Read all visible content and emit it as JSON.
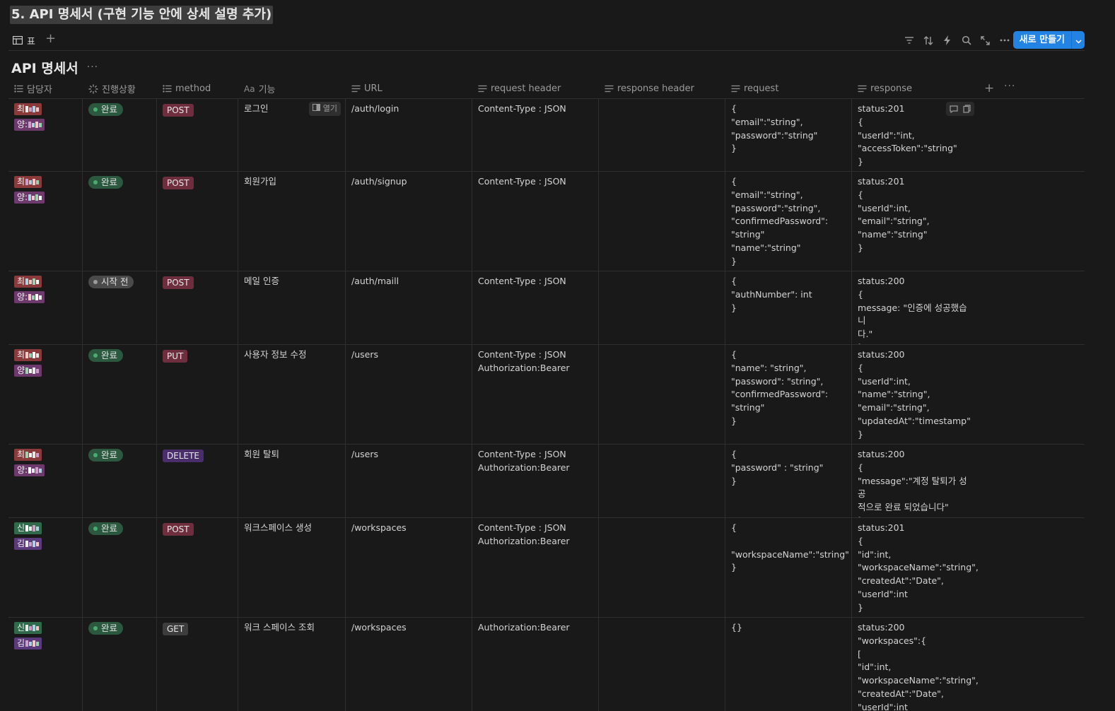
{
  "page": {
    "title": "5. API 명세서 (구현 기능 안에 상세 설명 추가)"
  },
  "toolbar": {
    "view_label": "표",
    "add_view": "+",
    "new_button": "새로 만들기"
  },
  "database": {
    "title": "API 명세서",
    "more": "···"
  },
  "columns": [
    {
      "key": "owner",
      "label": "담당자",
      "icon": "list-icon"
    },
    {
      "key": "status",
      "label": "진행상황",
      "icon": "status-icon"
    },
    {
      "key": "method",
      "label": "method",
      "icon": "list-icon"
    },
    {
      "key": "feature",
      "label": "기능",
      "icon": "title-icon",
      "icon_text": "Aa"
    },
    {
      "key": "url",
      "label": "URL",
      "icon": "text-icon"
    },
    {
      "key": "request_header",
      "label": "request header",
      "icon": "text-icon"
    },
    {
      "key": "response_header",
      "label": "response header",
      "icon": "text-icon"
    },
    {
      "key": "request",
      "label": "request",
      "icon": "text-icon"
    },
    {
      "key": "response",
      "label": "response",
      "icon": "text-icon"
    }
  ],
  "row_actions": {
    "open_label": "열기"
  },
  "rows": [
    {
      "owners": [
        {
          "name": "최",
          "color": "#8a3a3a"
        },
        {
          "name": "양:",
          "color": "#6e3a6e"
        }
      ],
      "status": "완료",
      "method": "POST",
      "feature": "로그인",
      "url": "/auth/login",
      "request_header": "Content-Type : JSON",
      "response_header": "",
      "request": "{\n\"email\":\"string\",\n\"password\":\"string\"\n}",
      "response": "status:201\n{\n\"userId\":\"int,\n\"accessToken\":\"string\"\n}"
    },
    {
      "owners": [
        {
          "name": "최",
          "color": "#8a3a3a"
        },
        {
          "name": "양:",
          "color": "#6e3a6e"
        }
      ],
      "status": "완료",
      "method": "POST",
      "feature": "회원가입",
      "url": "/auth/signup",
      "request_header": "Content-Type : JSON",
      "response_header": "",
      "request": "{\n\"email\":\"string\",\n\"password\":\"string\",\n\"confirmedPassword\":\n\"string\"\n\"name\":\"string\"\n}",
      "response": "status:201\n{\n\"userId\":int,\n\"email\":\"string\",\n\"name\":\"string\"\n}"
    },
    {
      "owners": [
        {
          "name": "최",
          "color": "#8a3a3a"
        },
        {
          "name": "양:",
          "color": "#6e3a6e"
        }
      ],
      "status": "시작 전",
      "method": "POST",
      "feature": "메일 인증",
      "url": "/auth/maill",
      "request_header": "Content-Type : JSON",
      "response_header": "",
      "request": "{\n\"authNumber\": int\n}",
      "response": "status:200\n{\nmessage: \"인증에 성공했습니\n다.\"\n}"
    },
    {
      "owners": [
        {
          "name": "최",
          "color": "#8a3a3a"
        },
        {
          "name": "양",
          "color": "#6e3a6e"
        }
      ],
      "status": "완료",
      "method": "PUT",
      "feature": "사용자 정보 수정",
      "url": "/users",
      "request_header": "Content-Type : JSON\nAuthorization:Bearer",
      "response_header": "",
      "request": "{\n\"name\": \"string\",\n\"password\": \"string\",\n\"confirmedPassword\":\n\"string\"\n}",
      "response": "status:200\n{\n\"userId\":int,\n\"name\":\"string\",\n\"email\":\"string\",\n\"updatedAt\":\"timestamp\"\n}"
    },
    {
      "owners": [
        {
          "name": "최",
          "color": "#8a3a3a"
        },
        {
          "name": "양:",
          "color": "#6e3a6e"
        }
      ],
      "status": "완료",
      "method": "DELETE",
      "feature": "회원 탈퇴",
      "url": "/users",
      "request_header": "Content-Type : JSON\nAuthorization:Bearer",
      "response_header": "",
      "request": "{\n\"password\" : \"string\"\n}",
      "response": "status:200\n{\n\"message\":\"계정 탈퇴가 성공\n적으로 완료 되었습니다\"\n}"
    },
    {
      "owners": [
        {
          "name": "신",
          "color": "#2f6b4a"
        },
        {
          "name": "김",
          "color": "#5a3a7a"
        }
      ],
      "status": "완료",
      "method": "POST",
      "feature": "워크스페이스 생성",
      "url": "/workspaces",
      "request_header": "Content-Type : JSON\nAuthorization:Bearer",
      "response_header": "",
      "request": "{\n \"workspaceName\":\"string\"\n}",
      "response": "status:201\n{\n\"id\":int,\n\"workspaceName\":\"string\",\n\"createdAt\":\"Date\",\n\"userId\":int\n}"
    },
    {
      "owners": [
        {
          "name": "신",
          "color": "#2f6b4a"
        },
        {
          "name": "김",
          "color": "#5a3a7a"
        }
      ],
      "status": "완료",
      "method": "GET",
      "feature": "워크 스페이스 조회",
      "url": "/workspaces",
      "request_header": "Authorization:Bearer",
      "response_header": "",
      "request": "{}",
      "response": "status:200\n\"workspaces\":{\n[\n\"id\":int,\n\"workspaceName\":\"string\",\n\"createdAt\":\"Date\",\n\"userId\":int"
    }
  ],
  "colors": {
    "status_done_bg": "#2b593f",
    "status_done_dot": "#4dab6f",
    "status_todo_bg": "#4a4a4a",
    "status_todo_dot": "#9b9b9b",
    "method_post": "#6f2e3e",
    "method_put": "#6f2e3e",
    "method_delete": "#4a2e6b",
    "method_get": "#3d3d3d",
    "primary": "#2383e2"
  }
}
